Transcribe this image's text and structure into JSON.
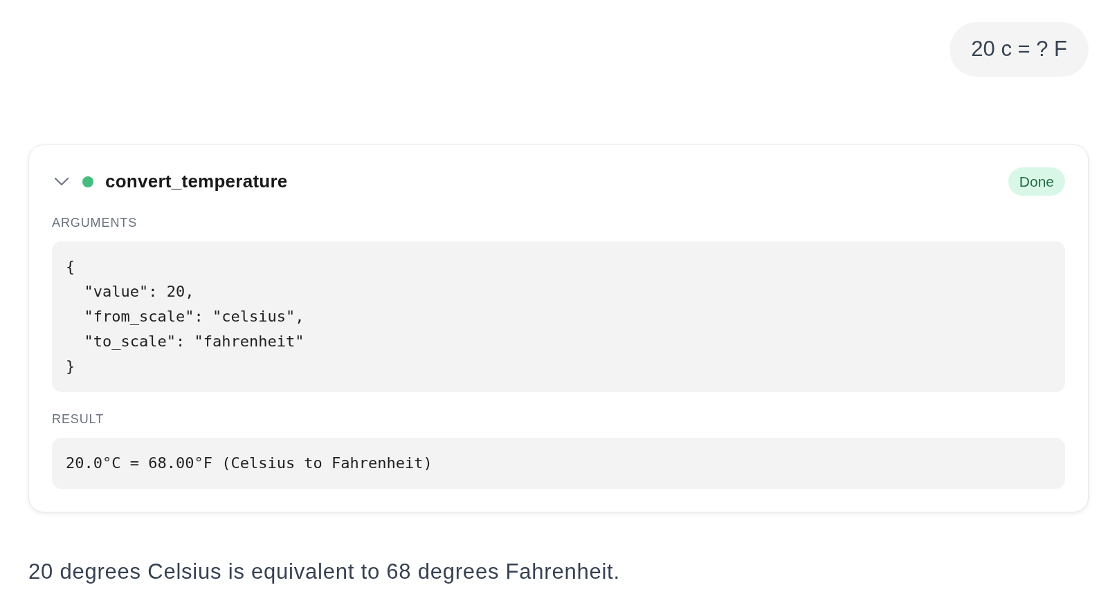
{
  "user_message": {
    "text": "20 c = ? F"
  },
  "tool_call": {
    "expanded": true,
    "color": "#45bd80",
    "name": "convert_temperature",
    "status": "Done",
    "sections": [
      {
        "label": "ARGUMENTS",
        "lines": [
          "{",
          "  \"value\": 20,",
          "  \"from_scale\": \"celsius\",",
          "  \"to_scale\": \"fahrenheit\"",
          "}"
        ]
      },
      {
        "label": "RESULT",
        "lines": [
          "20.0°C = 68.00°F (Celsius to Fahrenheit)"
        ]
      }
    ]
  },
  "assistant_message": {
    "text": "20 degrees Celsius is equivalent to 68 degrees Fahrenheit."
  }
}
